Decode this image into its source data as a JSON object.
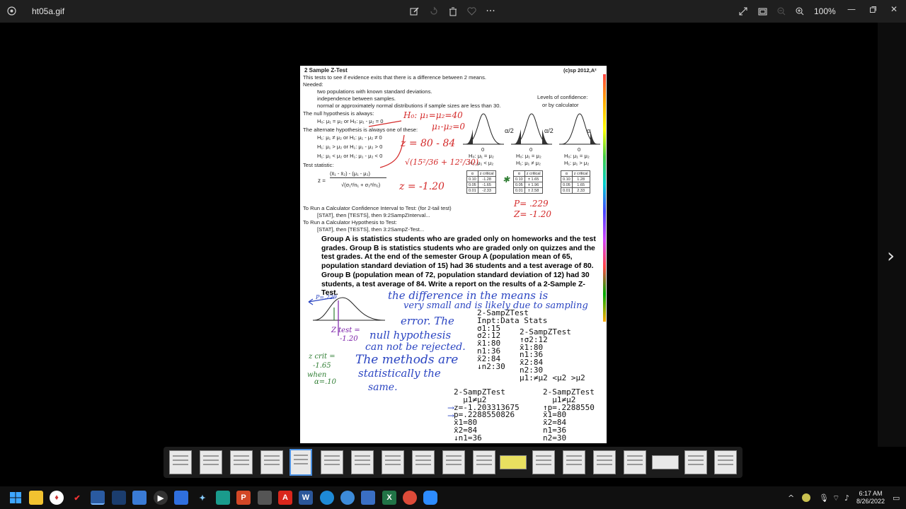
{
  "window": {
    "title": "ht05a.gif",
    "zoom": "100%"
  },
  "toolbar": {
    "icons": [
      "edit-icon",
      "rotate-icon",
      "delete-icon",
      "favorite-icon",
      "more-icon"
    ],
    "right_icons": [
      "fullscreen-icon",
      "slideshow-icon",
      "zoom-out-icon",
      "zoom-in-icon"
    ]
  },
  "window_controls": [
    "minimize",
    "maximize",
    "close"
  ],
  "document": {
    "header_title": "2 Sample Z-Test",
    "copyright": "(c)sp 2012,A²",
    "intro": "This tests to see if evidence exits that there is a difference between 2 means.",
    "needed_label": "Needed:",
    "needed": [
      "two populations with known standard deviations.",
      "independence between samples.",
      "normal or approximately normal distributions if sample sizes are less than 30."
    ],
    "levels_title": "Levels of confidence:",
    "levels_sub": "or by calculator",
    "null_label": "The null hypothesis is always:",
    "null_text": "H₀: μ₁ = μ₂ or H₀: μ₁ - μ₂ = 0",
    "alt_label": "The alternate hypothesis is always one of these:",
    "alt_lines": [
      "H₁: μ₁ ≠ μ₂ or H₁: μ₁ - μ₂ ≠ 0",
      "H₁: μ₁ > μ₂ or H₁: μ₁ - μ₂ > 0",
      "H₁: μ₁ < μ₂ or H₁: μ₁ - μ₂ < 0"
    ],
    "test_stat_label": "Test statistic:",
    "formula_num": "(x̄₁ - x̄₂) - (μ₁ - μ₂)",
    "formula_den": "√(σ₁²/n₁ + σ₂²/n₂)",
    "formula_z": "z =",
    "calc_lines": [
      "To Run a Calculator Confidence Interval to Test: (for 2-tail test)",
      "[STAT], then [TESTS], then 9:2SampZInterval...",
      "To Run a Calculator Hypothesis to Test:",
      "[STAT], then [TESTS], then 3:2SampZ-Test..."
    ],
    "curves": [
      {
        "alpha_left": "",
        "alpha_right": "α",
        "zero": "0",
        "h0": "H₀: μ₁ = μ₂",
        "h1": "H₁: μ₁ < μ₂"
      },
      {
        "alpha_left": "α/2",
        "alpha_right": "α/2",
        "zero": "0",
        "h0": "H₀: μ₁ = μ₂",
        "h1": "H₁: μ₁ ≠ μ₂"
      },
      {
        "alpha_left": "",
        "alpha_right": "α",
        "zero": "0",
        "h0": "H₀: μ₁ = μ₂",
        "h1": "H₁: μ₁ > μ₂"
      }
    ],
    "tables": [
      {
        "head": [
          "α",
          "z critical"
        ],
        "rows": [
          [
            "0.10",
            "-1.28"
          ],
          [
            "0.05",
            "-1.65"
          ],
          [
            "0.01",
            "-2.33"
          ]
        ]
      },
      {
        "head": [
          "α",
          "z critical"
        ],
        "rows": [
          [
            "0.10",
            "± 1.65"
          ],
          [
            "0.05",
            "± 1.96"
          ],
          [
            "0.01",
            "± 2.58"
          ]
        ]
      },
      {
        "head": [
          "α",
          "z critical"
        ],
        "rows": [
          [
            "0.10",
            "1.28"
          ],
          [
            "0.05",
            "1.65"
          ],
          [
            "0.01",
            "2.33"
          ]
        ]
      }
    ],
    "problem": "Group A is statistics students who are graded only on homeworks and the test grades. Group B is statistics students who are graded only on quizzes and the test grades. At the end of the semester Group A (population mean of 65, population standard deviation of 15) had 36 students and a test average of 80. Group B (population mean of 72, population standard deviation of 12) had 30 students, a test average of 84. Write a report on the results of a 2-Sample Z-Test."
  },
  "handwriting": {
    "h0": "H₀: μ₁=μ₂=40",
    "h0b": "μ₁-μ₂=0",
    "z_eq": "z = 80 - 84",
    "fraction": "√(15²/36 + 12²/30)",
    "z_val": "z = -1.20",
    "p_val": "P= .229",
    "z_val2": "Z= -1.20",
    "p_mark": "P=.229",
    "z_test": "Z test =",
    "z_test_val": "-1.20",
    "z_crit": "z crit =",
    "z_crit_val": "-1.65",
    "when": "when",
    "alpha": "α=.10",
    "blue_text": [
      "the difference in the means is",
      "very small and is likely due to sampling",
      "error. The",
      "null hypothesis",
      "can not be rejected.",
      "The methods are",
      "statistically the",
      "same."
    ]
  },
  "calculator": {
    "screen1": [
      "2-SampZTest",
      "Inpt:Data Stats",
      "σ1:15",
      "σ2:12",
      "x̄1:80",
      "n1:36",
      "x̄2:84",
      "↓n2:30"
    ],
    "screen2": [
      "2-SampZTest",
      "↑σ2:12",
      "x̄1:80",
      "n1:36",
      "x̄2:84",
      "n2:30",
      "μ1:≠μ2 <μ2 >μ2"
    ],
    "screen3": [
      "2-SampZTest",
      "  μ1≠μ2",
      "z=-1.203313675",
      "p=.2288550826",
      "x̄1=80",
      "x̄2=84",
      "↓n1=36"
    ],
    "screen4": [
      "2-SampZTest",
      "  μ1≠μ2",
      "↑p=.2288550",
      "x̄1=80",
      "x̄2=84",
      "n1=36",
      "n2=30"
    ]
  },
  "taskbar": {
    "apps": [
      "start",
      "file-explorer",
      "app-1",
      "app-2",
      "photos",
      "app-3",
      "app-4",
      "media-player",
      "app-5",
      "app-6",
      "app-7",
      "powerpoint",
      "camera",
      "acrobat",
      "word",
      "edge",
      "notepad",
      "excel",
      "chrome",
      "zoom"
    ],
    "time": "6:17 AM",
    "date": "8/26/2022"
  }
}
